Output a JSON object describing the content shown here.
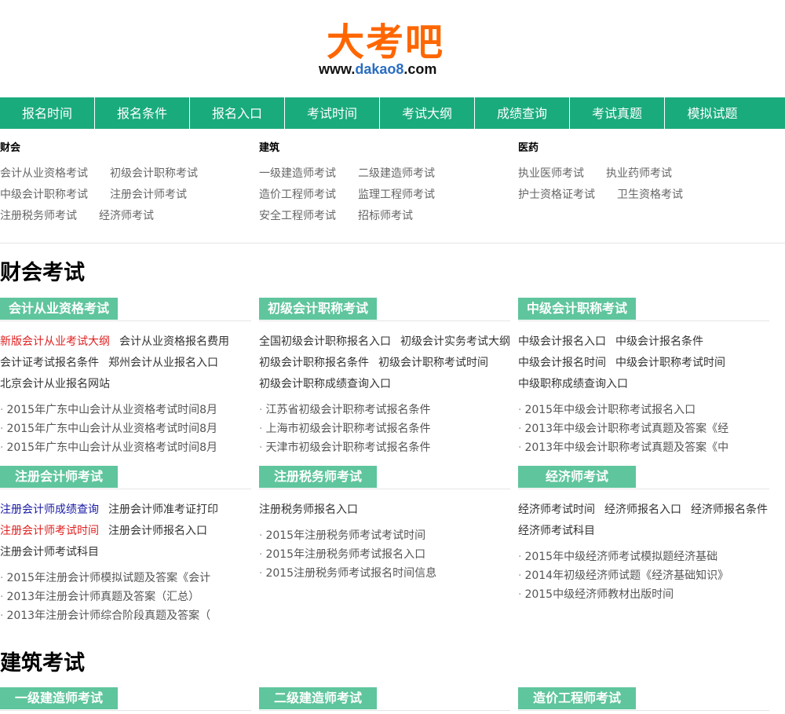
{
  "logo": {
    "cn": "大考吧",
    "url_a": "www.",
    "url_b": "dakao8",
    "url_c": ".com"
  },
  "nav": [
    "报名时间",
    "报名条件",
    "报名入口",
    "考试时间",
    "考试大纲",
    "成绩查询",
    "考试真题",
    "模拟试题"
  ],
  "categories": [
    {
      "title": "财会",
      "rows": [
        [
          "会计从业资格考试",
          "初级会计职称考试"
        ],
        [
          "中级会计职称考试",
          "注册会计师考试"
        ],
        [
          "注册税务师考试",
          "经济师考试"
        ]
      ]
    },
    {
      "title": "建筑",
      "rows": [
        [
          "一级建造师考试",
          "二级建造师考试"
        ],
        [
          "造价工程师考试",
          "监理工程师考试"
        ],
        [
          "安全工程师考试",
          "招标师考试"
        ]
      ]
    },
    {
      "title": "医药",
      "rows": [
        [
          "执业医师考试",
          "执业药师考试"
        ],
        [
          "护士资格证考试",
          "卫生资格考试"
        ]
      ]
    }
  ],
  "section_caikuai": "财会考试",
  "section_jianzhu": "建筑考试",
  "boxes": [
    {
      "title": "会计从业资格考试",
      "hot": [
        [
          "新版会计从业考试大纲",
          "会计从业资格报名费用"
        ],
        [
          "会计证考试报名条件",
          "郑州会计从业报名入口"
        ],
        [
          "北京会计从业报名网站"
        ]
      ],
      "items": [
        "2015年广东中山会计从业资格考试时间8月",
        "2015年广东中山会计从业资格考试时间8月",
        "2015年广东中山会计从业资格考试时间8月"
      ]
    },
    {
      "title": "初级会计职称考试",
      "hot": [
        [
          "全国初级会计职称报名入口",
          "初级会计实务考试大纲"
        ],
        [
          "初级会计职称报名条件",
          "初级会计职称考试时间"
        ],
        [
          "初级会计职称成绩查询入口"
        ]
      ],
      "items": [
        "江苏省初级会计职称考试报名条件",
        "上海市初级会计职称考试报名条件",
        "天津市初级会计职称考试报名条件"
      ]
    },
    {
      "title": "中级会计职称考试",
      "hot": [
        [
          "中级会计报名入口",
          "中级会计报名条件"
        ],
        [
          "中级会计报名时间",
          "中级会计职称考试时间"
        ],
        [
          "中级职称成绩查询入口"
        ]
      ],
      "items": [
        "2015年中级会计职称考试报名入口",
        "2013年中级会计职称考试真题及答案《经",
        "2013年中级会计职称考试真题及答案《中"
      ]
    },
    {
      "title": "注册会计师考试",
      "hot": [
        [
          "注册会计师成绩查询",
          "注册会计师准考证打印"
        ],
        [
          "注册会计师考试时间",
          "注册会计师报名入口"
        ],
        [
          "注册会计师考试科目"
        ]
      ],
      "items": [
        "2015年注册会计师模拟试题及答案《会计",
        "2013年注册会计师真题及答案（汇总）",
        "2013年注册会计师综合阶段真题及答案（"
      ]
    },
    {
      "title": "注册税务师考试",
      "hot": [
        [
          "注册税务师报名入口"
        ]
      ],
      "items": [
        "2015年注册税务师考试考试时间",
        "2015年注册税务师考试报名入口",
        "2015注册税务师考试报名时间信息"
      ]
    },
    {
      "title": "经济师考试",
      "hot": [
        [
          "经济师考试时间",
          "经济师报名入口",
          "经济师报名条件"
        ],
        [
          "经济师考试科目"
        ]
      ],
      "items": [
        "2015年中级经济师考试模拟题经济基础",
        "2014年初级经济师试题《经济基础知识》",
        "2015中级经济师教材出版时间"
      ]
    },
    {
      "title": "一级建造师考试",
      "hot": [],
      "items": []
    },
    {
      "title": "二级建造师考试",
      "hot": [],
      "items": []
    },
    {
      "title": "造价工程师考试",
      "hot": [],
      "items": []
    }
  ],
  "colors": {
    "nav_bg": "#1aab7c",
    "tab_bg": "#5fc59d",
    "logo_orange": "#ff6600",
    "red_link": "#e02020",
    "blue_link": "#1a1aa6"
  }
}
